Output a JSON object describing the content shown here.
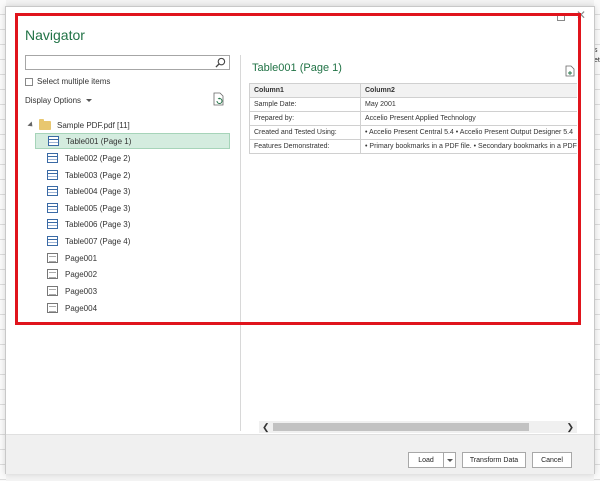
{
  "dialog": {
    "title": "Navigator"
  },
  "left": {
    "search_placeholder": "",
    "select_multiple_label": "Select multiple items",
    "display_options_label": "Display Options",
    "root": {
      "label": "Sample PDF.pdf [11]"
    },
    "items": [
      {
        "label": "Table001 (Page 1)",
        "kind": "table",
        "selected": true
      },
      {
        "label": "Table002 (Page 2)",
        "kind": "table"
      },
      {
        "label": "Table003 (Page 2)",
        "kind": "table"
      },
      {
        "label": "Table004 (Page 3)",
        "kind": "table"
      },
      {
        "label": "Table005 (Page 3)",
        "kind": "table"
      },
      {
        "label": "Table006 (Page 3)",
        "kind": "table"
      },
      {
        "label": "Table007 (Page 4)",
        "kind": "table"
      },
      {
        "label": "Page001",
        "kind": "page"
      },
      {
        "label": "Page002",
        "kind": "page"
      },
      {
        "label": "Page003",
        "kind": "page"
      },
      {
        "label": "Page004",
        "kind": "page"
      }
    ]
  },
  "preview": {
    "title": "Table001 (Page 1)",
    "columns": [
      "Column1",
      "Column2"
    ],
    "rows": [
      [
        "Sample Date:",
        "May 2001"
      ],
      [
        "Prepared by:",
        "Accelio Present Applied Technology"
      ],
      [
        "Created and Tested Using:",
        "• Accelio Present Central 5.4 • Accelio Present Output Designer 5.4"
      ],
      [
        "Features Demonstrated:",
        "• Primary bookmarks in a PDF file. • Secondary bookmarks in a PDF file."
      ]
    ]
  },
  "footer": {
    "load_label": "Load",
    "transform_label": "Transform Data",
    "cancel_label": "Cancel"
  },
  "background": {
    "right_labels": [
      "s",
      "et"
    ]
  },
  "colors": {
    "accent": "#217346",
    "selection": "#d4ecdf",
    "highlight": "#e0141c"
  }
}
